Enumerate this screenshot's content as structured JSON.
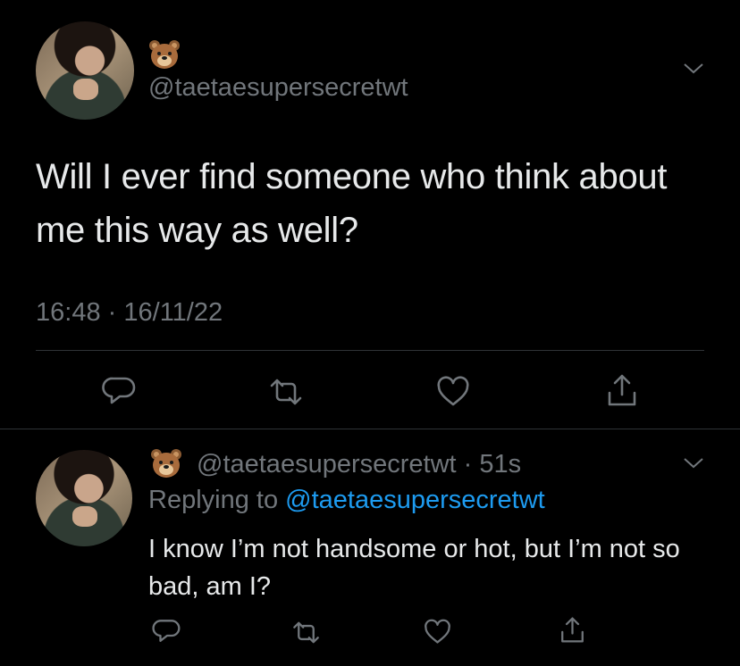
{
  "main_tweet": {
    "display_name": "🐻",
    "handle": "@taetaesupersecretwt",
    "text": "Will I ever find someone who think about me this way as well?",
    "time": "16:48",
    "separator": "·",
    "date": "16/11/22"
  },
  "reply_tweet": {
    "display_name": "🐻",
    "handle": "@taetaesupersecretwt",
    "separator": "·",
    "age": "51s",
    "replying_prefix": "Replying to",
    "replying_to": "@taetaesupersecretwt",
    "text": "I know I’m not handsome or hot, but I’m not so bad, am I?"
  },
  "colors": {
    "background": "#000000",
    "text": "#e7e9ea",
    "muted": "#71767b",
    "link": "#1d9bf0",
    "divider": "#2f3336"
  },
  "icons": [
    "reply-icon",
    "retweet-icon",
    "like-icon",
    "share-icon",
    "chevron-down-icon"
  ]
}
